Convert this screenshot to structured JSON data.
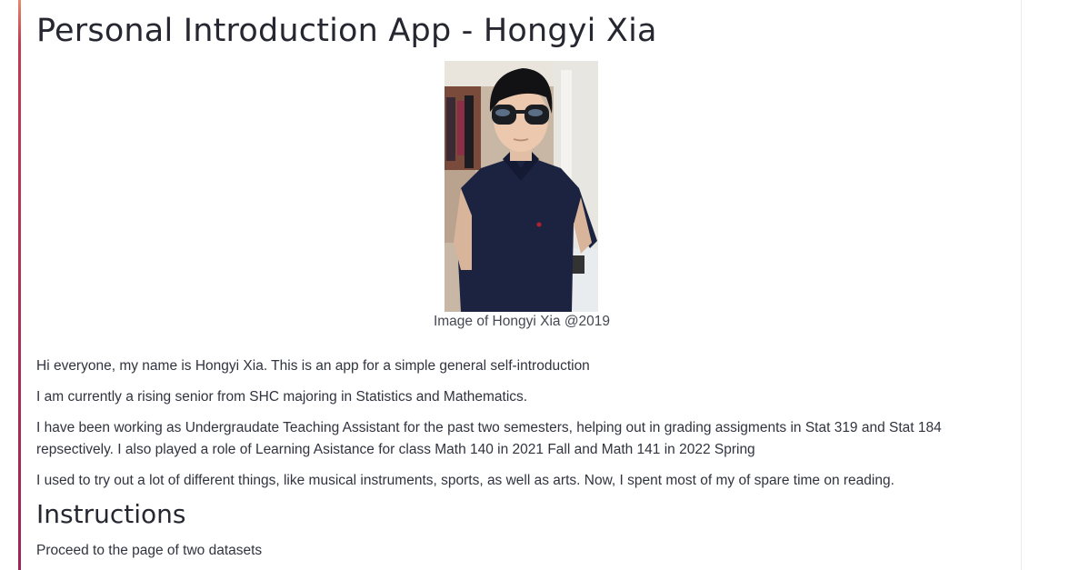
{
  "app": {
    "title": "Personal Introduction App - Hongyi Xia"
  },
  "image": {
    "icon": "portrait-photo",
    "caption": "Image of Hongyi Xia @2019"
  },
  "intro": {
    "paragraphs": [
      "Hi everyone, my name is Hongyi Xia. This is an app for a simple general self-introduction",
      "I am currently a rising senior from SHC majoring in Statistics and Mathematics.",
      "I have been working as Undergraudate Teaching Assistant for the past two semesters, helping out in grading assigments in Stat 319 and Stat 184 repsectively. I also played a role of Learning Asistance for class Math 140 in 2021 Fall and Math 141 in 2022 Spring",
      "I used to try out a lot of different things, like musical instruments, sports, as well as arts. Now, I spent most of my of spare time on reading."
    ]
  },
  "instructions": {
    "heading": "Instructions",
    "text": "Proceed to the page of two datasets"
  },
  "colors": {
    "accent_top": "#e48a6a",
    "accent_bottom": "#9c2457",
    "text": "#31333f"
  }
}
